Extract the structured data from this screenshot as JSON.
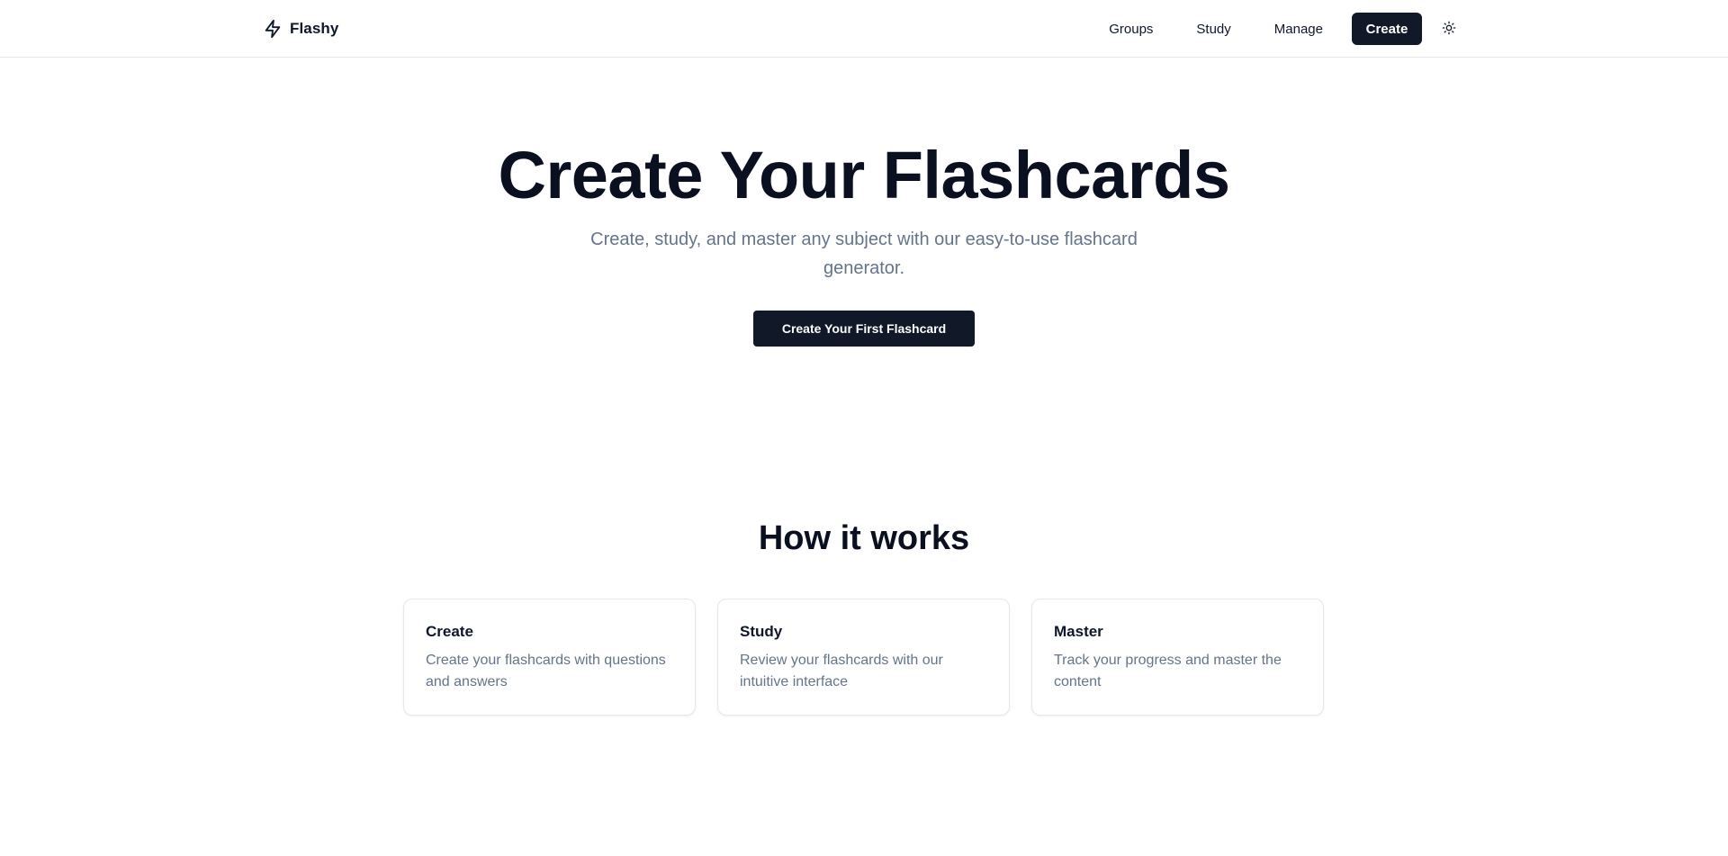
{
  "header": {
    "brand": "Flashy",
    "nav": [
      {
        "label": "Groups"
      },
      {
        "label": "Study"
      },
      {
        "label": "Manage"
      }
    ],
    "create_label": "Create",
    "icons": {
      "logo": "lightning-bolt-icon",
      "theme": "sun-icon"
    }
  },
  "hero": {
    "title": "Create Your Flashcards",
    "subtitle": "Create, study, and master any subject with our easy-to-use flashcard generator.",
    "cta_label": "Create Your First Flashcard"
  },
  "how_it_works": {
    "title": "How it works",
    "cards": [
      {
        "title": "Create",
        "description": "Create your flashcards with questions and answers"
      },
      {
        "title": "Study",
        "description": "Review your flashcards with our intuitive interface"
      },
      {
        "title": "Master",
        "description": "Track your progress and master the content"
      }
    ]
  },
  "colors": {
    "primary": "#111827",
    "text": "#0f172a",
    "muted": "#64748b",
    "border": "#e5e7eb",
    "background": "#ffffff"
  }
}
